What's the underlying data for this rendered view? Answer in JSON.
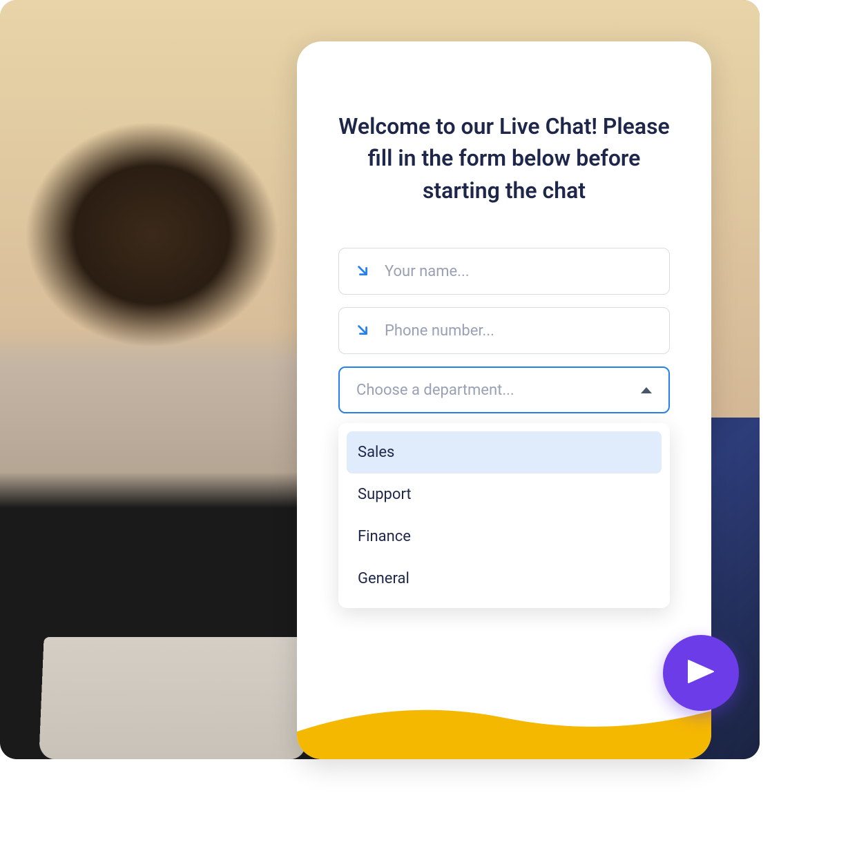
{
  "chat": {
    "title": "Welcome to our Live Chat! Please fill in the form below before starting the chat",
    "name_placeholder": "Your name...",
    "phone_placeholder": "Phone number...",
    "department_placeholder": "Choose a department...",
    "departments": [
      {
        "label": "Sales",
        "highlighted": true
      },
      {
        "label": "Support",
        "highlighted": false
      },
      {
        "label": "Finance",
        "highlighted": false
      },
      {
        "label": "General",
        "highlighted": false
      }
    ]
  },
  "colors": {
    "accent_blue": "#2680eb",
    "accent_purple": "#6b3ce8",
    "accent_yellow": "#f5b800",
    "text_dark": "#1e2749",
    "placeholder": "#9aa0b4",
    "highlight_bg": "#e0ebfc"
  }
}
